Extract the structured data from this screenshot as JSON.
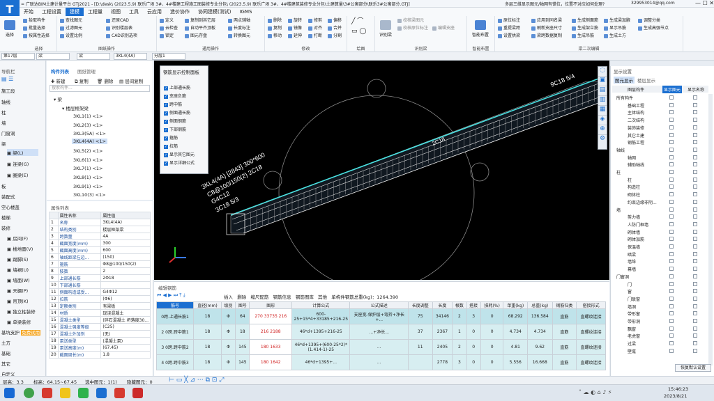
{
  "titlebar": {
    "text": "= 广联达BIM土建计量平台 GTJ2021 - [D:\\desk\\ (2023.5.9) 联乐广场 3#、4#楼建工程施工图装修专业分包\\ (2023.5.9) 联乐广场 3#、4#楼建筑装修专业分包\\土建算量\\3#公寓部分\\联乐3#公寓部分.GTJ]",
    "right_text": "多层三维显示图元/轴网有错位，位置不对应如何处理?",
    "user": "329953014@qq.com",
    "logo": "T"
  },
  "menus": [
    "开始",
    "工程设置",
    "建模",
    "工程量",
    "视图",
    "工具",
    "云应用",
    "造价协作",
    "协同建模(测试)",
    "IGMS"
  ],
  "active_menu": "建模",
  "ribbon": {
    "select": "选择",
    "g1": {
      "items": [
        "拾取构件",
        "批量选择",
        "按属性选择"
      ],
      "label": "选择"
    },
    "g2": {
      "items": [
        "查找图元",
        "过滤图元",
        "设置比例",
        "还原CAD",
        "识别楼层表",
        "CAD识别选项"
      ],
      "label": "图纸操作"
    },
    "g3": {
      "items": [
        "定义",
        "云检查",
        "锁定",
        "复制到其它层",
        "自动平齐顶板",
        "图元存盘",
        "两点辅轴",
        "长度标注",
        "转换图元"
      ],
      "label": "通用操作"
    },
    "g4": {
      "items": [
        "删除",
        "复制",
        "移动",
        "旋转",
        "镜像",
        "延伸",
        "修剪",
        "对齐",
        "打断",
        "偏移",
        "合并",
        "分割"
      ],
      "label": "修改"
    },
    "g5": {
      "label": "绘图"
    },
    "g6": {
      "items": [
        "识别梁",
        "校核梁图元",
        "校核原位标注",
        "编辑支座"
      ],
      "label": "识别梁"
    },
    "g7": {
      "big": "智能布置",
      "label": "智能布置"
    },
    "g8": {
      "items": [
        "原位标注",
        "重提梁跨",
        "设置拱梁",
        "应用到同名梁",
        "刷新支座尺寸",
        "梁跨数据复制",
        "生成侧面筋",
        "生成架立筋",
        "生成吊筋",
        "生成梁加腋",
        "显示吊筋",
        "生成土方",
        "调整分类",
        "生成高强节点"
      ],
      "label": "梁二次编辑"
    }
  },
  "selectors": [
    "第17层",
    "梁",
    "梁",
    "3KL4(4A)",
    "分层1"
  ],
  "nav": {
    "title": "导航栏",
    "items": [
      "施工段",
      "轴线",
      "柱",
      "墙",
      "门窗洞",
      "梁",
      "梁(L)",
      "连梁(G)",
      "圈梁(E)",
      "板",
      "装配式",
      "空心楼盖",
      "楼梯",
      "装修",
      "房间(F)",
      "楼地面(V)",
      "踢脚(S)",
      "墙裙(U)",
      "墙面(W)",
      "天棚(P)",
      "吊顶(K)",
      "独立柱装修",
      "单梁装修",
      "基坑支护",
      "土方",
      "基础",
      "其它",
      "自定义"
    ],
    "free_badge": "免费试用"
  },
  "component": {
    "tabs": [
      "构件列表",
      "图纸管理"
    ],
    "toolbar": [
      "新建",
      "复制",
      "删除",
      "层间复制"
    ],
    "search_placeholder": "搜索构件...",
    "root": "梁",
    "folder": "楼层框架梁",
    "items": [
      "3KL1(1) <1>",
      "3KL2(3) <1>",
      "3KL3(5A) <1>",
      "3KL4(4A) <1>",
      "3KL5(2) <1>",
      "3KL6(1) <1>",
      "3KL7(1) <1>",
      "3KL8(1) <1>",
      "3KL9(1) <1>",
      "3KL10(3) <1>"
    ],
    "selected": "3KL4(4A) <1>"
  },
  "properties": {
    "title": "属性列表",
    "headers": [
      "属性名称",
      "属性值"
    ],
    "rows": [
      [
        "1",
        "名称",
        "3KL4(4A)"
      ],
      [
        "2",
        "结构类别",
        "楼层框架梁"
      ],
      [
        "3",
        "跨数量",
        "4A"
      ],
      [
        "4",
        "截面宽度(mm)",
        "300"
      ],
      [
        "5",
        "截面高度(mm)",
        "600"
      ],
      [
        "6",
        "轴线距梁左边...",
        "(150)"
      ],
      [
        "7",
        "箍筋",
        "Φ8@100/150(2)"
      ],
      [
        "8",
        "肢数",
        "2"
      ],
      [
        "9",
        "上部通长筋",
        "2Φ18"
      ],
      [
        "10",
        "下部通长筋",
        ""
      ],
      [
        "11",
        "侧面构造或受...",
        "G4Φ12"
      ],
      [
        "12",
        "拉筋",
        "(Φ6)"
      ],
      [
        "13",
        "定额类别",
        "有梁板"
      ],
      [
        "14",
        "材质",
        "现浇混凝土"
      ],
      [
        "15",
        "混凝土类型",
        "(碎石混凝土 坍落度30..."
      ],
      [
        "16",
        "混凝土强度等级",
        "(C25)"
      ],
      [
        "17",
        "混凝土外加剂",
        "(无)"
      ],
      [
        "18",
        "泵送类型",
        "(混凝土泵)"
      ],
      [
        "19",
        "泵送高度(m)",
        "(67.45)"
      ],
      [
        "20",
        "截面周长(m)",
        "1.8"
      ]
    ]
  },
  "viewport": {
    "panel_title": "钢筋显示控制面板",
    "checks": [
      "上部通长筋",
      "支座负筋",
      "跨中筋",
      "侧面通长筋",
      "侧面钢筋",
      "下部钢筋",
      "箍筋",
      "拉筋",
      "显示其它图元",
      "显示详细公式"
    ],
    "annot1": "3KL4(4A) [2843] 300*600",
    "annot2": "C8@100/150(2) 2C18",
    "annot3": "G4C12",
    "annot4": "3C18 5/3",
    "annot5": "9C18 5/4",
    "annot6": "2C18"
  },
  "edit": {
    "title": "编辑钢筋",
    "toolbar": [
      "插入",
      "删除",
      "缩尺配筋",
      "钢筋信息",
      "钢筋图库",
      "其他",
      "单构件钢筋总重(kg)：1264.390"
    ],
    "headers": [
      "筋号",
      "直径(mm)",
      "级别",
      "图号",
      "图形",
      "计算公式",
      "公式描述",
      "长度调整",
      "长度",
      "根数",
      "搭接",
      "损耗(%)",
      "单重(kg)",
      "总重(kg)",
      "钢筋归类",
      "搭接形式"
    ],
    "rows": [
      [
        "0跨.上通长筋1",
        "18",
        "Φ",
        "64",
        "270  33735  216",
        "600-25+15*4+33185+216-25",
        "支座宽-保护层+弯折+净长+...",
        "75",
        "34146",
        "2",
        "3",
        "0",
        "68.292",
        "136.584",
        "直筋",
        "直螺纹连接"
      ],
      [
        "2 0跨.跨中筋1",
        "18",
        "Φ",
        "18",
        "216   2188",
        "46*d+1395+216-25",
        "...+净长...",
        "37",
        "2367",
        "1",
        "0",
        "0",
        "4.734",
        "4.734",
        "直筋",
        "直螺纹连接"
      ],
      [
        "3 0跨.跨中筋2",
        "18",
        "Φ",
        "145",
        "180  1633",
        "46*d+1395+(600-25*2)*(1.414-1)-25",
        "...",
        "11",
        "2405",
        "2",
        "0",
        "0",
        "4.81",
        "9.62",
        "直筋",
        "直螺纹连接"
      ],
      [
        "4 0跨.跨中筋3",
        "18",
        "Φ",
        "145",
        "180  1642",
        "46*d+1395+...",
        "...",
        "",
        "2778",
        "3",
        "0",
        "0",
        "5.556",
        "16.668",
        "直筋",
        "直螺纹连接"
      ]
    ]
  },
  "right": {
    "title": "显示设置",
    "tabs": [
      "图元显示",
      "楼层显示"
    ],
    "headers": [
      "图层构件",
      "显示图元",
      "显示名称"
    ],
    "rows": [
      "所有构件",
      "基础工程",
      "主体结构",
      "二次结构",
      "装饰装修",
      "其它土建",
      "钢筋工程",
      "轴线",
      "轴网",
      "辅助轴线",
      "柱",
      "柱",
      "构造柱",
      "砌体柱",
      "约束边缘非阴...",
      "墙",
      "剪力墙",
      "人防门框墙",
      "砌体墙",
      "砌体加筋",
      "保温墙",
      "暗梁",
      "墙垛",
      "幕墙",
      "门窗洞",
      "门",
      "窗",
      "门联窗",
      "墙洞",
      "带形窗",
      "带形洞",
      "飘窗",
      "老虎窗",
      "过梁",
      "壁龛"
    ],
    "restore": "恢复默认设置"
  },
  "status": {
    "floor": "层高：3.3",
    "elev": "标高：64.15~67.45",
    "selected": "选中图元：1(1)",
    "hidden": "隐藏图元：0"
  },
  "taskbar": {
    "time": "15:46:23",
    "date": "2023/8/21"
  }
}
